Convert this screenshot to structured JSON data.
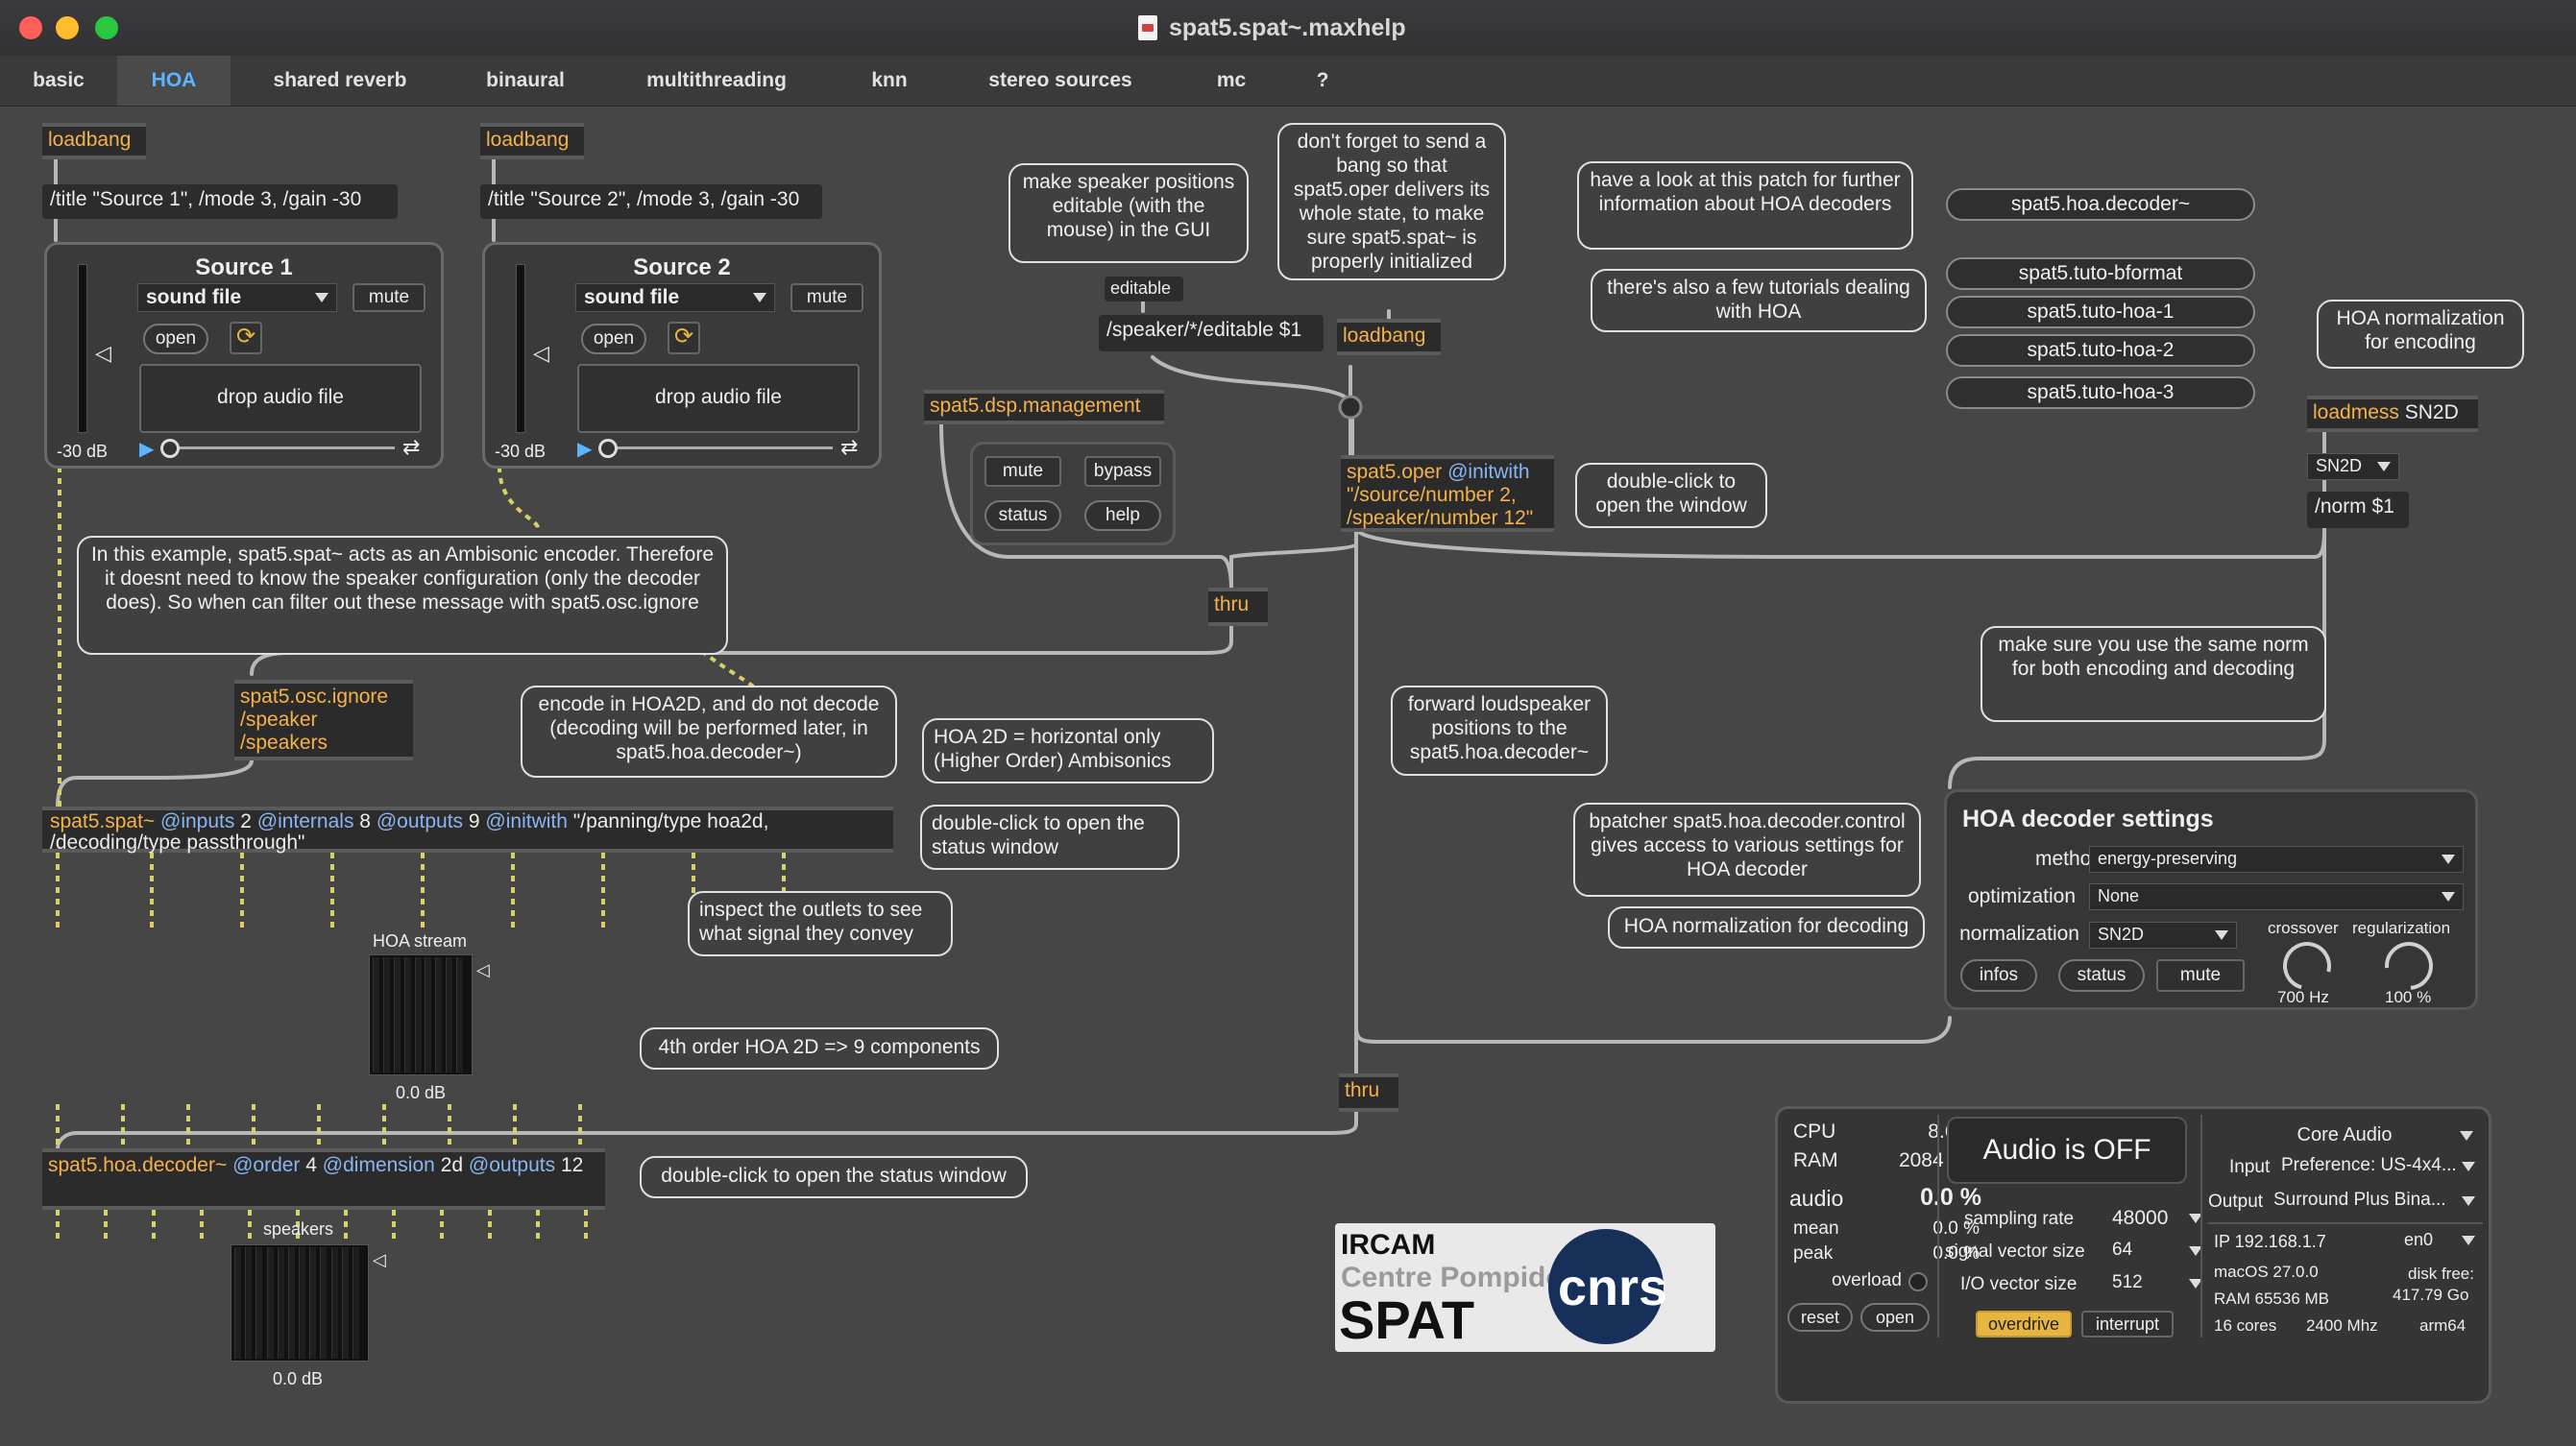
{
  "window": {
    "title": "spat5.spat~.maxhelp"
  },
  "tabs": [
    {
      "label": "basic"
    },
    {
      "label": "HOA"
    },
    {
      "label": "shared reverb"
    },
    {
      "label": "binaural"
    },
    {
      "label": "multithreading"
    },
    {
      "label": "knn"
    },
    {
      "label": "stereo sources"
    },
    {
      "label": "mc"
    },
    {
      "label": "?"
    }
  ],
  "objects": {
    "loadbang": "loadbang",
    "title1": "/title \"Source 1\", /mode 3, /gain -30",
    "title2": "/title \"Source 2\", /mode 3, /gain -30",
    "editable": "editable",
    "speaker_editable": "/speaker/*/editable $1",
    "dsp_management": "spat5.dsp.management",
    "thru": "thru",
    "oper_name": "spat5.oper",
    "oper_attr": "@initwith",
    "oper_args": "\"/source/number 2,\n/speaker/number 12\"",
    "osc_ignore": "spat5.osc.ignore\n/speaker\n/speakers",
    "spat_name": "spat5.spat~",
    "spat_inputs": "@inputs",
    "spat_inputs_v": "2",
    "spat_internals": "@internals",
    "spat_internals_v": "8",
    "spat_outputs": "@outputs",
    "spat_outputs_v": "9",
    "spat_initwith": "@initwith",
    "spat_initwith_v": "\"/panning/type hoa2d,",
    "spat_line2": "/decoding/type passthrough\"",
    "decoder_name": "spat5.hoa.decoder~",
    "decoder_order": "@order",
    "decoder_order_v": "4",
    "decoder_dim": "@dimension",
    "decoder_dim_v": "2d",
    "decoder_outputs": "@outputs",
    "decoder_outputs_v": "12",
    "loadmess": "loadmess",
    "loadmess_v": "SN2D",
    "norm_sel": "SN2D",
    "norm_msg": "/norm $1"
  },
  "sources": [
    {
      "title": "Source 1",
      "file": "sound file",
      "mute": "mute",
      "open": "open",
      "drop": "drop audio file",
      "gain": "-30 dB"
    },
    {
      "title": "Source 2",
      "file": "sound file",
      "mute": "mute",
      "open": "open",
      "drop": "drop audio file",
      "gain": "-30 dB"
    }
  ],
  "dsp_panel": {
    "mute": "mute",
    "bypass": "bypass",
    "status": "status",
    "help": "help"
  },
  "comments": {
    "speaker_editable": "make speaker positions editable (with the mouse) in the GUI",
    "bang_note": "don't forget to send a bang so that spat5.oper delivers its whole state, to make sure spat5.spat~ is properly initialized",
    "hoa_look": "have a look at this patch for further information about HOA decoders",
    "tutorials": "there's also a few tutorials dealing with HOA",
    "hoa_norm_enc": "HOA normalization for encoding",
    "double_click_window": "double-click to open the window",
    "ambisonic": "In this example, spat5.spat~ acts as an Ambisonic encoder. Therefore it doesnt need to know the speaker configuration (only the decoder does). So when can filter out these message with spat5.osc.ignore",
    "encode_hoa": "encode in HOA2D, and do not decode (decoding will be performed later, in spat5.hoa.decoder~)",
    "hoa2d": "HOA 2D = horizontal only (Higher Order) Ambisonics",
    "forward": "forward loudspeaker positions to the spat5.hoa.decoder~",
    "same_norm": "make sure you use the same norm for both encoding and decoding",
    "status_window": "double-click to open the status window",
    "inspect": "inspect the outlets to see what signal they convey",
    "fourth_order": "4th order HOA 2D => 9 components",
    "bpatcher": "bpatcher spat5.hoa.decoder.control gives access to various settings for HOA decoder",
    "hoa_norm_dec": "HOA normalization for decoding",
    "status_window2": "double-click to open the status window"
  },
  "links": {
    "decoder": "spat5.hoa.decoder~",
    "bformat": "spat5.tuto-bformat",
    "hoa1": "spat5.tuto-hoa-1",
    "hoa2": "spat5.tuto-hoa-2",
    "hoa3": "spat5.tuto-hoa-3"
  },
  "meters": {
    "hoa_label": "HOA stream",
    "hoa_db": "0.0 dB",
    "hoa_level": 0.0,
    "spk_label": "speakers",
    "spk_db": "0.0 dB",
    "spk_level": 0.0
  },
  "decoder_settings": {
    "title": "HOA decoder settings",
    "method_label": "method",
    "method_value": "energy-preserving",
    "optimization_label": "optimization",
    "optimization_value": "None",
    "normalization_label": "normalization",
    "normalization_value": "SN2D",
    "crossover_label": "crossover",
    "crossover_value": "700 Hz",
    "regularization_label": "regularization",
    "regularization_value": "100 %",
    "infos": "infos",
    "status": "status",
    "mute": "mute"
  },
  "dsp_status": {
    "cpu_label": "CPU",
    "cpu_value": "8.6 %",
    "ram_label": "RAM",
    "ram_value": "2084 MB",
    "audio_label": "audio",
    "audio_value": "0.0 %",
    "mean_label": "mean",
    "mean_value": "0.0 %",
    "peak_label": "peak",
    "peak_value": "0.0 %",
    "overload_label": "overload",
    "reset": "reset",
    "open": "open",
    "audio_state": "Audio is OFF",
    "sr_label": "sampling rate",
    "sr_value": "48000",
    "sv_label": "signal vector size",
    "sv_value": "64",
    "io_label": "I/O vector size",
    "io_value": "512",
    "overdrive": "overdrive",
    "interrupt": "interrupt",
    "driver": "Core Audio",
    "input_label": "Input",
    "input_value": "Preference: US-4x4...",
    "output_label": "Output",
    "output_value": "Surround Plus Bina...",
    "ip_value": "IP 192.168.1.7",
    "iface": "en0",
    "os": "macOS 27.0.0",
    "ram_total": "RAM 65536 MB",
    "cores": "16 cores",
    "mhz": "2400 Mhz",
    "arch": "arm64",
    "disk_label": "disk free:",
    "disk_value": "417.79 Go"
  },
  "logo": {
    "ircam": "IRCAM",
    "pompidou": "Centre Pompidou",
    "spat": "SPAT",
    "cnrs": "cnrs"
  },
  "colors": {
    "accent": "#5ab4ff",
    "orange": "#f5b14c",
    "attr_blue": "#89b5f2",
    "overdrive": "#e8b640",
    "cable": "#b8b8b8",
    "signal_cable": "#d8d16a"
  }
}
